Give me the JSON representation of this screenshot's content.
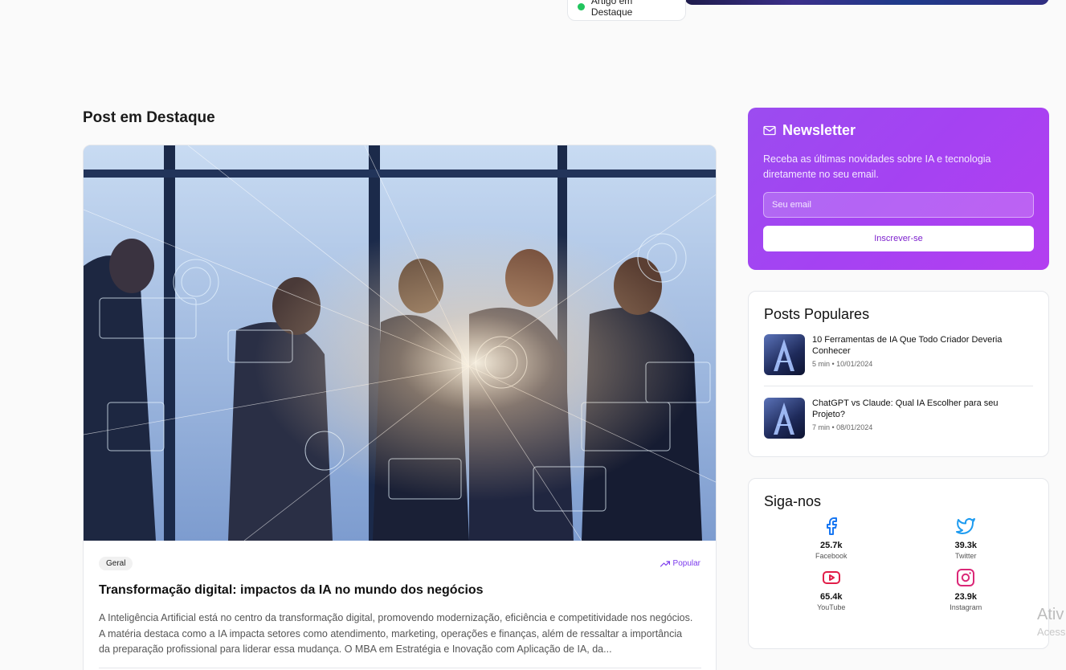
{
  "top": {
    "featured_badge": "Artigo em Destaque"
  },
  "section": {
    "title": "Post em Destaque"
  },
  "featured_post": {
    "category": "Geral",
    "badge": "Popular",
    "title": "Transformação digital: impactos da IA no mundo dos negócios",
    "excerpt": "A Inteligência Artificial está no centro da transformação digital, promovendo modernização, eficiência e competitividade nos negócios. A matéria destaca como a IA impacta setores como atendimento, marketing, operações e finanças, além de ressaltar a importância da preparação profissional para liderar essa mudança. O MBA em Estratégia e Inovação com Aplicação de IA, da..."
  },
  "newsletter": {
    "title": "Newsletter",
    "description": "Receba as últimas novidades sobre IA e tecnologia diretamente no seu email.",
    "email_placeholder": "Seu email",
    "subscribe_label": "Inscrever-se"
  },
  "popular_posts": {
    "title": "Posts Populares",
    "items": [
      {
        "title": "10 Ferramentas de IA Que Todo Criador Deveria Conhecer",
        "meta": "5 min • 10/01/2024"
      },
      {
        "title": "ChatGPT vs Claude: Qual IA Escolher para seu Projeto?",
        "meta": "7 min • 08/01/2024"
      }
    ]
  },
  "follow": {
    "title": "Siga-nos",
    "networks": [
      {
        "icon": "facebook-icon",
        "count": "25.7k",
        "name": "Facebook",
        "color": "#1877f2"
      },
      {
        "icon": "twitter-icon",
        "count": "39.3k",
        "name": "Twitter",
        "color": "#1d9bf0"
      },
      {
        "icon": "youtube-icon",
        "count": "65.4k",
        "name": "YouTube",
        "color": "#e11d48"
      },
      {
        "icon": "instagram-icon",
        "count": "23.9k",
        "name": "Instagram",
        "color": "#db2777"
      }
    ]
  },
  "watermark": {
    "line1": "Ativ",
    "line2": "Acess"
  },
  "colors": {
    "accent": "#9b4cf0",
    "status_dot": "#22c55e",
    "popular": "#7c3aed"
  }
}
